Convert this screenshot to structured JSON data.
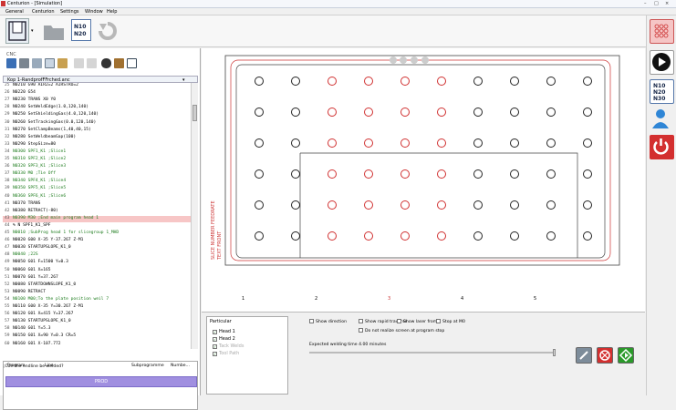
{
  "window": {
    "title": "Centurion - [Simulation]",
    "minimize": "–",
    "maximize": "□",
    "close": "×"
  },
  "menu": [
    "General",
    "Centurion",
    "Settings",
    "Window",
    "Help"
  ],
  "toolbar": {
    "nc_icon": "N10 N20",
    "icons": [
      "part-frame-icon",
      "folder-icon",
      "nc-code-icon",
      "refresh-icon"
    ]
  },
  "cnc": {
    "label": "CNC",
    "tab_title": "Kop 1-RandprofFFrched.anc",
    "lines": [
      {
        "n": "25",
        "t": "N0210 G90 AIR2=2 AIRSTRO=2"
      },
      {
        "n": "26",
        "t": "N0220 G54"
      },
      {
        "n": "27",
        "t": "N0230 TRANS X0 Y0"
      },
      {
        "n": "28",
        "t": "N0240 SetWeldEdge(1.0,120,140)"
      },
      {
        "n": "29",
        "t": "N0250 SetShieldingGas(4.0,120,140)"
      },
      {
        "n": "30",
        "t": "N0260 SetTrackingGas(0.0,120,140)"
      },
      {
        "n": "31",
        "t": "N0270 SetClampBeams(1,40,40,15)"
      },
      {
        "n": "32",
        "t": "N0280 SetWeldbeamGap(100)"
      },
      {
        "n": "33",
        "t": "N0290 StepSize=80"
      },
      {
        "n": "34",
        "t": "N0300 SPF1_K1 ;Slice1"
      },
      {
        "n": "35",
        "t": "N0310 SPF2_K1 ;Slice2"
      },
      {
        "n": "36",
        "t": "N0320 SPF3_K1 ;Slice3"
      },
      {
        "n": "37",
        "t": "N0330 M0 ;Tie Off"
      },
      {
        "n": "38",
        "t": "N0340 SPF4_K1 ;Slice4"
      },
      {
        "n": "39",
        "t": "N0350 SPF5_K1 ;Slice5"
      },
      {
        "n": "40",
        "t": "N0360 SPF6_K1 ;Slice6"
      },
      {
        "n": "41",
        "t": "N0370 TRANS"
      },
      {
        "n": "42",
        "t": "N0380 RETRACT(-80)"
      },
      {
        "n": "43",
        "t": "N0390 M30 ;End main program head 1"
      },
      {
        "n": "44",
        "t": "% N SPF1_K1_SPF"
      },
      {
        "n": "45",
        "t": "N0010 ;SubProg head 1 for slicegroup 1_MHD"
      },
      {
        "n": "46",
        "t": "N0020 G00 X-35 Y-37.267 Z-M1"
      },
      {
        "n": "47",
        "t": "N0030 STARTUPSLOPE_K1_0"
      },
      {
        "n": "48",
        "t": "N0040 ;22S"
      },
      {
        "n": "49",
        "t": "N0050 G01 F=1500 Y=0.3"
      },
      {
        "n": "50",
        "t": "N0060 G01 X=165"
      },
      {
        "n": "51",
        "t": "N0070 G01 Y=37.267"
      },
      {
        "n": "52",
        "t": "N0080 STARTDOWNSLOPE_K1_0"
      },
      {
        "n": "53",
        "t": "N0090 RETRACT"
      },
      {
        "n": "54",
        "t": "N0100 M00;To the plate position weil 7"
      },
      {
        "n": "55",
        "t": "N0110 G00 X-35 Y=30.267 Z-M1"
      },
      {
        "n": "56",
        "t": "N0120 G01 X=415 Y=37.267"
      },
      {
        "n": "57",
        "t": "N0130 STARTUPSLOPE_K1_0"
      },
      {
        "n": "58",
        "t": "N0140 G01 Y=5.3"
      },
      {
        "n": "59",
        "t": "N0150 G01 X=90 Y=0.3 CR=5"
      },
      {
        "n": "60",
        "t": "N0160 G01 X-107.772"
      }
    ],
    "highlight_line": 18,
    "columns": [
      "Program",
      "Line",
      "Subprogramme",
      "Numbe..."
    ],
    "question": ";Can the endline be welded?",
    "prod_button": "PROD"
  },
  "ruler": [
    "1",
    "2",
    "3",
    "4",
    "5"
  ],
  "canvas": {
    "side_label_1": "SLICE NUMBER FEEDRATE",
    "side_label_2": "TEXT FRONT"
  },
  "particular": {
    "title": "Particular",
    "items": [
      {
        "label": "Head 1",
        "checked": true,
        "dim": false
      },
      {
        "label": "Head 2",
        "checked": true,
        "dim": false
      },
      {
        "label": "Tack Welds",
        "checked": true,
        "dim": true
      },
      {
        "label": "Tool Path",
        "checked": true,
        "dim": true
      }
    ]
  },
  "options": {
    "show_direction": "Show direction",
    "show_rapid": "Show rapid traverse",
    "show_laser": "Show laser from",
    "stop_m0": "Stop at M0",
    "dont_realize": "Do not realize screen at program stop"
  },
  "expected_time": "Expected welding time 4.00 minutes",
  "colors": {
    "prod": "#a08fe0",
    "red_circle": "#d03030",
    "black_circle": "#222222",
    "accent_green": "#2a9a2a"
  }
}
